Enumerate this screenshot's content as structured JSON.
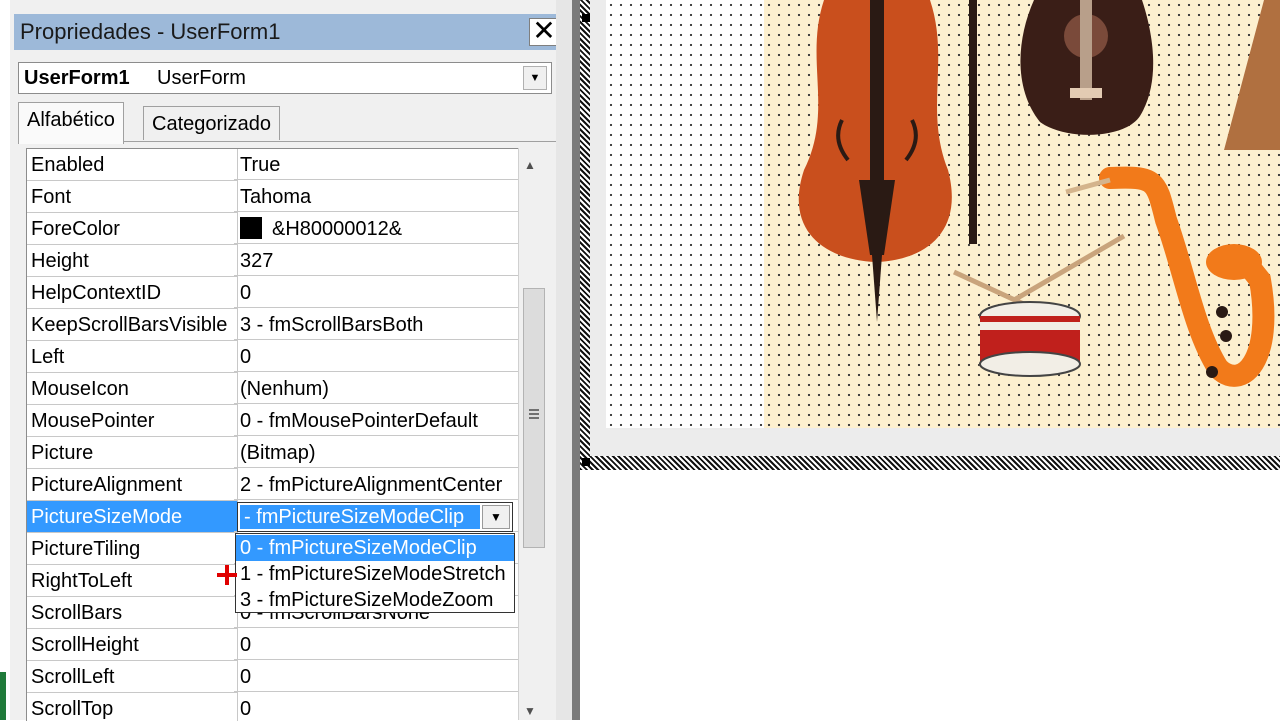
{
  "window": {
    "title": "Propriedades - UserForm1",
    "close_glyph": "✕"
  },
  "object_selector": {
    "name": "UserForm1",
    "type": "UserForm"
  },
  "tabs": [
    {
      "label": "Alfabético",
      "active": true
    },
    {
      "label": "Categorizado",
      "active": false
    }
  ],
  "properties": [
    {
      "name": "Enabled",
      "value": "True"
    },
    {
      "name": "Font",
      "value": "Tahoma"
    },
    {
      "name": "ForeColor",
      "value": "&H80000012&",
      "swatch": "#000000"
    },
    {
      "name": "Height",
      "value": "327"
    },
    {
      "name": "HelpContextID",
      "value": "0"
    },
    {
      "name": "KeepScrollBarsVisible",
      "value": "3 - fmScrollBarsBoth"
    },
    {
      "name": "Left",
      "value": "0"
    },
    {
      "name": "MouseIcon",
      "value": "(Nenhum)"
    },
    {
      "name": "MousePointer",
      "value": "0 - fmMousePointerDefault"
    },
    {
      "name": "Picture",
      "value": "(Bitmap)"
    },
    {
      "name": "PictureAlignment",
      "value": "2 - fmPictureAlignmentCenter"
    },
    {
      "name": "PictureSizeMode",
      "value": "",
      "selected": true
    },
    {
      "name": "PictureTiling",
      "value": ""
    },
    {
      "name": "RightToLeft",
      "value": ""
    },
    {
      "name": "ScrollBars",
      "value": "0 - fmScrollBarsNone"
    },
    {
      "name": "ScrollHeight",
      "value": "0"
    },
    {
      "name": "ScrollLeft",
      "value": "0"
    },
    {
      "name": "ScrollTop",
      "value": "0"
    }
  ],
  "picture_size_mode": {
    "current_text": " - fmPictureSizeModeClip",
    "options": [
      {
        "label": "0 - fmPictureSizeModeClip",
        "highlighted": true
      },
      {
        "label": "1 - fmPictureSizeModeStretch",
        "highlighted": false
      },
      {
        "label": "3 - fmPictureSizeModeZoom",
        "highlighted": false
      }
    ]
  },
  "icons": {
    "dropdown": "chevron-down-icon",
    "scroll_up": "scroll-up-icon",
    "scroll_down": "scroll-down-icon",
    "cursor": "cross-cursor-icon"
  },
  "colors": {
    "title_bar": "#9db9d9",
    "selection": "#3399ff",
    "picture_bg": "#fdf0cf"
  }
}
